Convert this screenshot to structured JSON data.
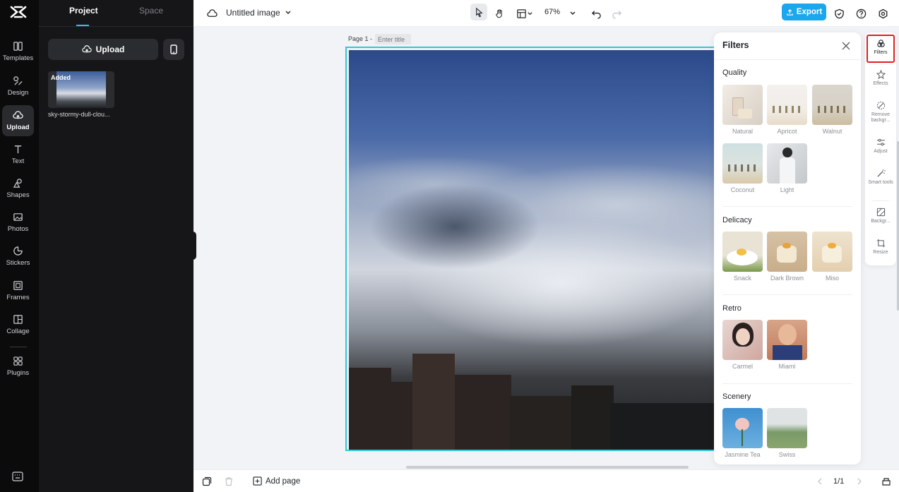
{
  "left_rail": {
    "items": [
      {
        "id": "templates",
        "label": "Templates",
        "icon": "templates-icon"
      },
      {
        "id": "design",
        "label": "Design",
        "icon": "design-icon"
      },
      {
        "id": "upload",
        "label": "Upload",
        "icon": "upload-cloud-icon",
        "active": true
      },
      {
        "id": "text",
        "label": "Text",
        "icon": "text-icon"
      },
      {
        "id": "shapes",
        "label": "Shapes",
        "icon": "shapes-icon"
      },
      {
        "id": "photos",
        "label": "Photos",
        "icon": "photos-icon"
      },
      {
        "id": "stickers",
        "label": "Stickers",
        "icon": "stickers-icon"
      },
      {
        "id": "frames",
        "label": "Frames",
        "icon": "frames-icon"
      },
      {
        "id": "collage",
        "label": "Collage",
        "icon": "collage-icon"
      },
      {
        "id": "plugins",
        "label": "Plugins",
        "icon": "plugins-icon"
      }
    ]
  },
  "panel": {
    "tabs": [
      {
        "label": "Project",
        "active": true
      },
      {
        "label": "Space",
        "active": false
      }
    ],
    "upload_label": "Upload",
    "asset": {
      "badge": "Added",
      "name": "sky-stormy-dull-clou..."
    }
  },
  "topbar": {
    "doc_title": "Untitled image",
    "zoom": "67%",
    "export_label": "Export"
  },
  "canvas": {
    "page_label": "Page 1 -",
    "title_placeholder": "Enter title"
  },
  "filters": {
    "title": "Filters",
    "sections": [
      {
        "name": "Quality",
        "items": [
          "Natural",
          "Apricot",
          "Walnut",
          "Coconut",
          "Light"
        ]
      },
      {
        "name": "Delicacy",
        "items": [
          "Snack",
          "Dark Brown",
          "Miso"
        ]
      },
      {
        "name": "Retro",
        "items": [
          "Carmel",
          "Miami"
        ]
      },
      {
        "name": "Scenery",
        "items": [
          "Jasmine Tea",
          "Swiss"
        ]
      }
    ]
  },
  "tools": [
    {
      "label": "Filters",
      "icon": "filters-icon",
      "active": true
    },
    {
      "label": "Effects",
      "icon": "effects-icon"
    },
    {
      "label": "Remove backgr...",
      "icon": "remove-background-icon"
    },
    {
      "label": "Adjust",
      "icon": "adjust-icon"
    },
    {
      "label": "Smart tools",
      "icon": "smart-tools-icon"
    },
    {
      "label": "Backgr...",
      "icon": "background-icon"
    },
    {
      "label": "Resize",
      "icon": "resize-icon"
    }
  ],
  "bottombar": {
    "add_page_label": "Add page",
    "pager": "1/1"
  },
  "colors": {
    "accent": "#1ba7ee",
    "selection": "#34c6d6",
    "highlight": "#e02020",
    "rail_bg": "#0b0b0c",
    "panel_bg": "#161618"
  }
}
